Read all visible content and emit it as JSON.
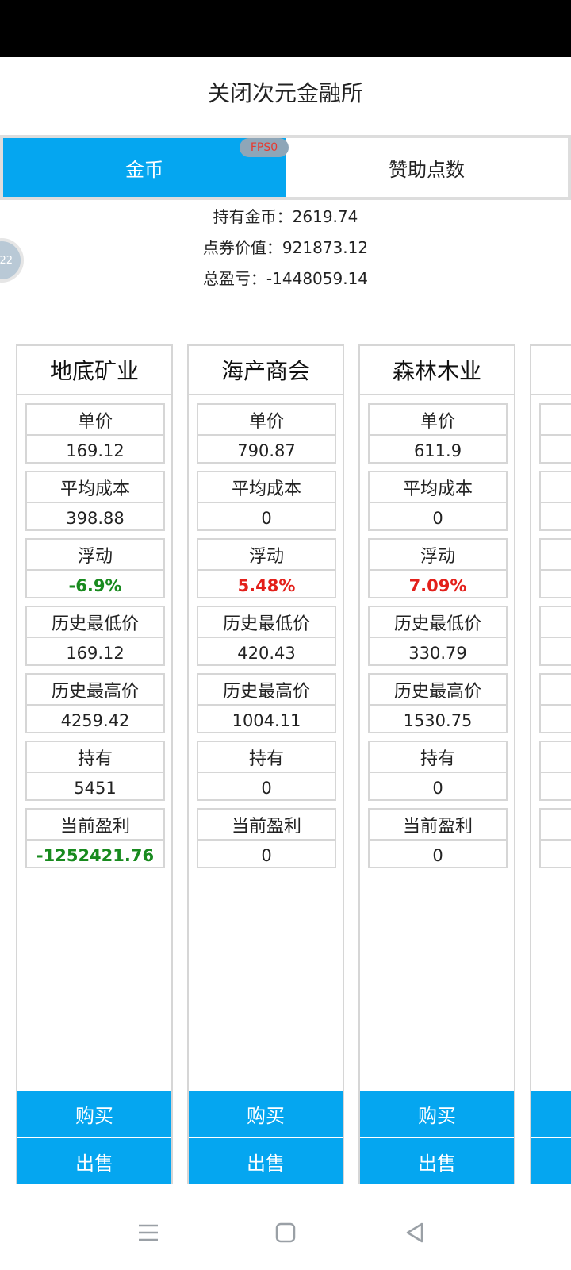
{
  "header": {
    "title": "关闭次元金融所"
  },
  "tabs": [
    {
      "label": "金币",
      "active": true
    },
    {
      "label": "赞助点数",
      "active": false
    }
  ],
  "fps_badge": "FPS0",
  "float_ball": "22",
  "summary": {
    "coins": "持有金币：2619.74",
    "voucher_value": "点券价值：921873.12",
    "total_pnl": "总盈亏：-1448059.14"
  },
  "stat_labels": {
    "price": "单价",
    "avg_cost": "平均成本",
    "change": "浮动",
    "hist_low": "历史最低价",
    "hist_high": "历史最高价",
    "holding": "持有",
    "profit": "当前盈利"
  },
  "buttons": {
    "buy": "购买",
    "sell": "出售"
  },
  "cards": [
    {
      "name": "地底矿业",
      "price": "169.12",
      "avg_cost": "398.88",
      "change": "-6.9%",
      "hist_low": "169.12",
      "hist_high": "4259.42",
      "holding": "5451",
      "profit": "-1252421.76"
    },
    {
      "name": "海产商会",
      "price": "790.87",
      "avg_cost": "0",
      "change": "5.48%",
      "hist_low": "420.43",
      "hist_high": "1004.11",
      "holding": "0",
      "profit": "0"
    },
    {
      "name": "森林木业",
      "price": "611.9",
      "avg_cost": "0",
      "change": "7.09%",
      "hist_low": "330.79",
      "hist_high": "1530.75",
      "holding": "0",
      "profit": "0"
    }
  ],
  "colors": {
    "accent": "#05a6f0",
    "negative": "#188a1e",
    "positive": "#e3201b"
  }
}
